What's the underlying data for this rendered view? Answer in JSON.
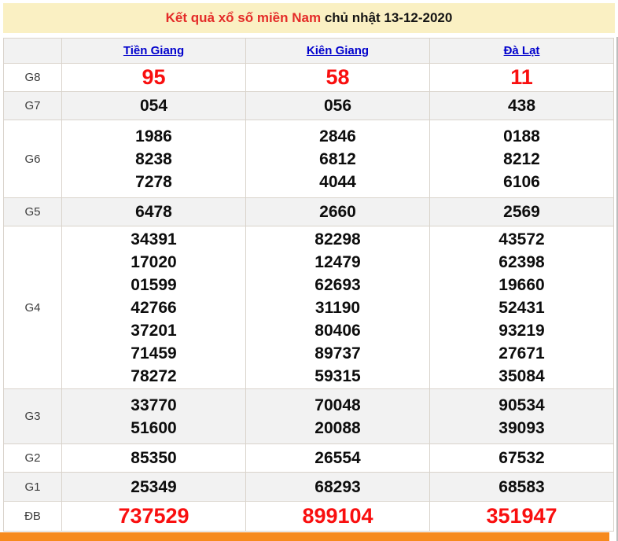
{
  "banner": {
    "title_main": "Kết quả xổ số miền Nam",
    "title_date": "chủ nhật 13-12-2020"
  },
  "table": {
    "columns": [
      "Tiền Giang",
      "Kiên Giang",
      "Đà Lạt"
    ],
    "rows": [
      {
        "label": "G8",
        "highlight": true,
        "cells": [
          [
            "95"
          ],
          [
            "58"
          ],
          [
            "11"
          ]
        ]
      },
      {
        "label": "G7",
        "highlight": false,
        "cells": [
          [
            "054"
          ],
          [
            "056"
          ],
          [
            "438"
          ]
        ]
      },
      {
        "label": "G6",
        "highlight": false,
        "cells": [
          [
            "1986",
            "8238",
            "7278"
          ],
          [
            "2846",
            "6812",
            "4044"
          ],
          [
            "0188",
            "8212",
            "6106"
          ]
        ]
      },
      {
        "label": "G5",
        "highlight": false,
        "cells": [
          [
            "6478"
          ],
          [
            "2660"
          ],
          [
            "2569"
          ]
        ]
      },
      {
        "label": "G4",
        "highlight": false,
        "cells": [
          [
            "34391",
            "17020",
            "01599",
            "42766",
            "37201",
            "71459",
            "78272"
          ],
          [
            "82298",
            "12479",
            "62693",
            "31190",
            "80406",
            "89737",
            "59315"
          ],
          [
            "43572",
            "62398",
            "19660",
            "52431",
            "93219",
            "27671",
            "35084"
          ]
        ]
      },
      {
        "label": "G3",
        "highlight": false,
        "cells": [
          [
            "33770",
            "51600"
          ],
          [
            "70048",
            "20088"
          ],
          [
            "90534",
            "39093"
          ]
        ]
      },
      {
        "label": "G2",
        "highlight": false,
        "cells": [
          [
            "85350"
          ],
          [
            "26554"
          ],
          [
            "67532"
          ]
        ]
      },
      {
        "label": "G1",
        "highlight": false,
        "cells": [
          [
            "25349"
          ],
          [
            "68293"
          ],
          [
            "68583"
          ]
        ]
      },
      {
        "label": "ĐB",
        "highlight": true,
        "cells": [
          [
            "737529"
          ],
          [
            "899104"
          ],
          [
            "351947"
          ]
        ]
      }
    ]
  },
  "colors": {
    "banner_background": "#faf0c3",
    "title_red": "#e42b28",
    "title_dark": "#151515",
    "link_blue": "#0000cc",
    "value_black": "#0d0d0d",
    "value_red": "#f90f0f",
    "row_alt_gray": "#f2f2f2",
    "border_gray": "#d9d3cb",
    "bottom_bar_orange": "#f68a1d"
  }
}
